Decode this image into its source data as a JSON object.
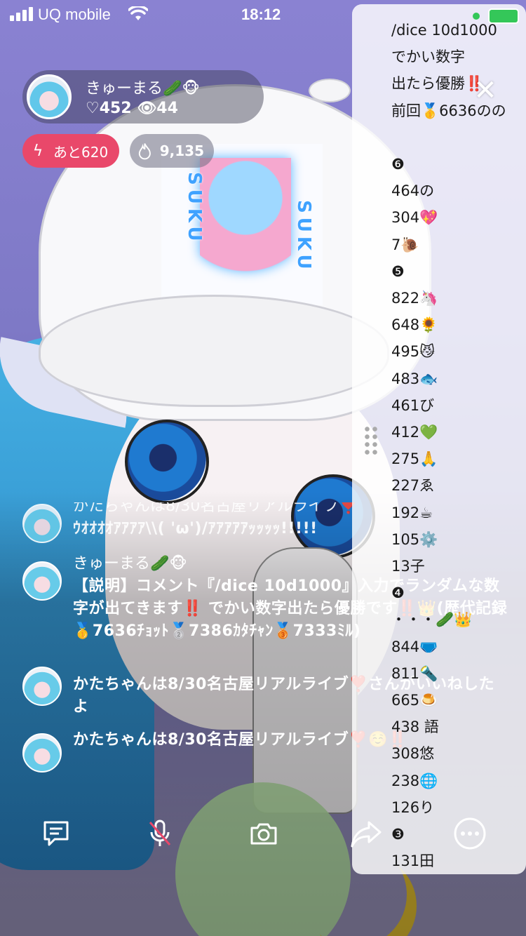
{
  "status_bar": {
    "carrier": "UQ mobile",
    "time": "18:12"
  },
  "streamer": {
    "name": "きゅーまる🥒🐵",
    "likes": "♡452",
    "viewers": "👁44"
  },
  "badges": {
    "remaining": "あと620",
    "points": "9,135"
  },
  "cap_patch": {
    "text_left": "SUKU",
    "text_right": "SUKU"
  },
  "comment_panel": {
    "text": "/dice 10d1000\nでかい数字\n出たら優勝‼️\n前回🥇6636のの\n\n❻\n464の\n304💖\n7🐌\n❺\n822🦄\n648🌻\n495😼\n483🐟\n461び\n412💚\n275🙏\n227ゑ\n192☕\n105⚙️\n13子\n❹\n・・・🥒👑\n844🩲\n811🔦\n665🍮\n438 語\n308悠\n238🌐\n126り\n❸\n131田"
  },
  "chat": [
    {
      "name": "かたちゃんは8/30名古屋リアルライブ❣️",
      "text": "ｳｵｵｵｵｱｱｱｱ\\\\( 'ω')/ｱｱｱｱｱｯｯｯｯ!!!!!"
    },
    {
      "name": "きゅーまる🥒🐵",
      "text": "【説明】コメント『/dice 10d1000』入力でランダムな数字が出てきます‼️ でかい数字出たら優勝です‼️👑(歴代記録🥇7636ﾁｮｯﾄ🥈7386ｶﾀﾁｬﾝ🥉7333ﾐﾙ)"
    },
    {
      "name": "",
      "text": "かたちゃんは8/30名古屋リアルライブ❣️さんがいいねしたよ"
    },
    {
      "name": "",
      "text": "かたちゃんは8/30名古屋リアルライブ❣️☺️‼️"
    }
  ],
  "toolbar": {
    "icons": [
      "comment-icon",
      "mic-muted-icon",
      "camera-icon",
      "share-icon",
      "more-icon"
    ]
  }
}
